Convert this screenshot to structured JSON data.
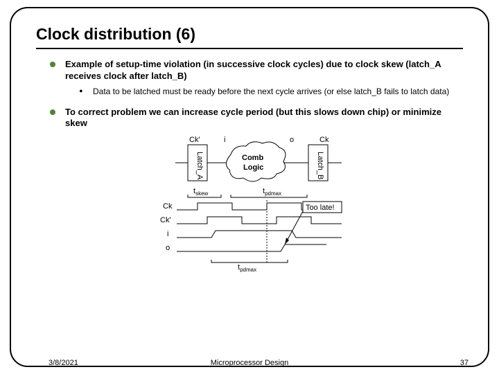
{
  "title": "Clock distribution (6)",
  "bullets": [
    {
      "text": "Example of setup-time violation (in successive clock cycles) due to clock skew (latch_A receives clock after latch_B)",
      "sub": [
        {
          "text": "Data to be latched must be ready before the next cycle arrives (or else latch_B fails to latch data)"
        }
      ]
    },
    {
      "text": "To correct problem we can increase cycle period (but this slows down chip) or minimize skew",
      "sub": []
    }
  ],
  "diagram": {
    "top_labels": {
      "ck_prime": "Ck'",
      "i": "i",
      "o": "o",
      "ck": "Ck"
    },
    "latch_a": "Latch_A",
    "comb_logic_line1": "Comb",
    "comb_logic_line2": "Logic",
    "latch_b": "Latch_B",
    "t_skew": "t",
    "t_skew_sub": "skew",
    "t_pdmax": "t",
    "t_pdmax_sub": "pdmax",
    "signals": [
      "Ck",
      "Ck'",
      "i",
      "o"
    ],
    "too_late": "Too late!"
  },
  "footer": {
    "date": "3/8/2021",
    "course": "Microprocessor Design",
    "page": "37"
  }
}
